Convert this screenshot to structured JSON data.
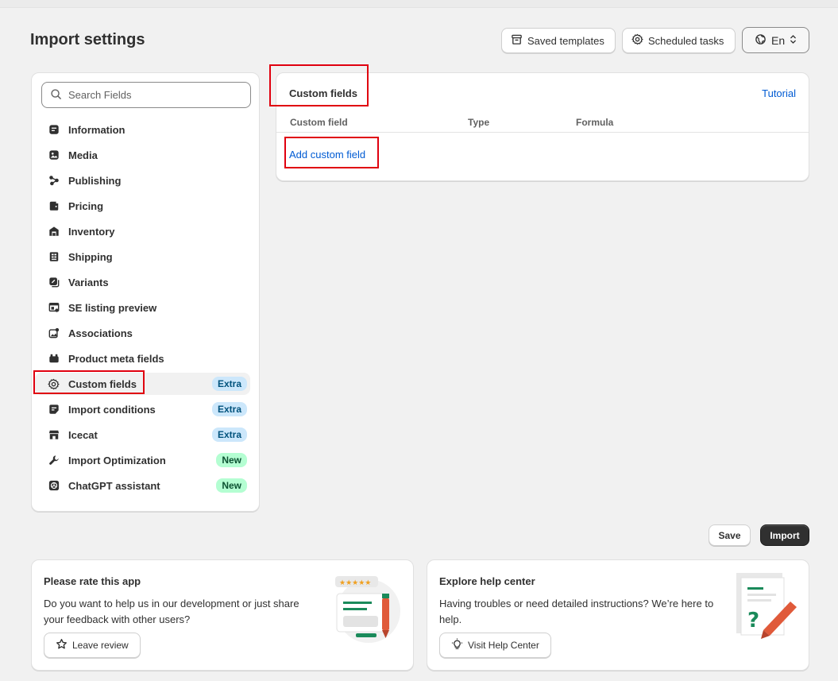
{
  "header": {
    "title": "Import settings",
    "saved_templates": "Saved templates",
    "scheduled_tasks": "Scheduled tasks",
    "language": "En"
  },
  "sidebar": {
    "search_placeholder": "Search Fields",
    "items": [
      {
        "label": "Information",
        "icon": "list-icon"
      },
      {
        "label": "Media",
        "icon": "image-icon"
      },
      {
        "label": "Publishing",
        "icon": "share-icon"
      },
      {
        "label": "Pricing",
        "icon": "wallet-icon"
      },
      {
        "label": "Inventory",
        "icon": "warehouse-icon"
      },
      {
        "label": "Shipping",
        "icon": "receipt-icon"
      },
      {
        "label": "Variants",
        "icon": "variants-icon"
      },
      {
        "label": "SE listing preview",
        "icon": "listing-icon"
      },
      {
        "label": "Associations",
        "icon": "associations-icon"
      },
      {
        "label": "Product meta fields",
        "icon": "meta-icon"
      },
      {
        "label": "Custom fields",
        "icon": "gear-icon",
        "badge": "Extra"
      },
      {
        "label": "Import conditions",
        "icon": "conditions-icon",
        "badge": "Extra"
      },
      {
        "label": "Icecat",
        "icon": "store-icon",
        "badge": "Extra"
      },
      {
        "label": "Import Optimization",
        "icon": "wrench-icon",
        "badge": "New"
      },
      {
        "label": "ChatGPT assistant",
        "icon": "openai-icon",
        "badge": "New"
      }
    ]
  },
  "custom_fields": {
    "title": "Custom fields",
    "tutorial": "Tutorial",
    "columns": [
      "Custom field",
      "Type",
      "Formula"
    ],
    "add_link": "Add custom field"
  },
  "actions": {
    "save": "Save",
    "import": "Import"
  },
  "rate": {
    "title": "Please rate this app",
    "text": "Do you want to help us in our development or just share your feedback with other users?",
    "button": "Leave review"
  },
  "help": {
    "title": "Explore help center",
    "text": "Having troubles or need detailed instructions? We’re here to help.",
    "button": "Visit Help Center"
  },
  "colors": {
    "accent_link": "#005bd3",
    "highlight_red": "#e0000f",
    "badge_extra_bg": "#cce7fb",
    "badge_new_bg": "#b4fed2",
    "primary_button": "#303030"
  }
}
